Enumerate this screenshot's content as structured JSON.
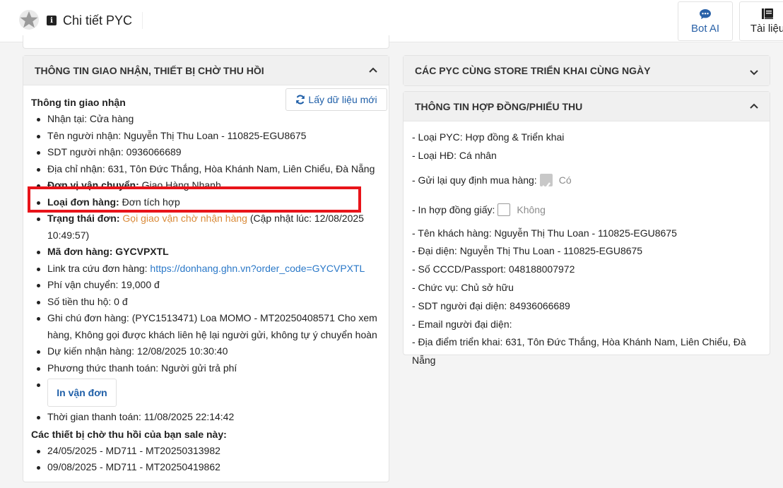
{
  "header": {
    "title": "Chi tiết PYC",
    "bot_ai_label": "Bot AI",
    "docs_label": "Tài liệu"
  },
  "left_panel": {
    "title": "THÔNG TIN GIAO NHẬN, THIẾT BỊ CHỜ THU HỒI",
    "section_delivery": "Thông tin giao nhận",
    "refresh_label": "Lấy dữ liệu mới",
    "items": {
      "receive_at": "Nhận tại: Cửa hàng",
      "receiver_name": "Tên người nhận: Nguyễn Thị Thu Loan - 110825-EGU8675",
      "receiver_phone": "SDT người nhận: 0936066689",
      "address": "Địa chỉ nhận: 631, Tôn Đức Thắng, Hòa Khánh Nam, Liên Chiểu, Đà Nẵng",
      "carrier_label": "Đơn vị vận chuyển:",
      "carrier_value": "Giao Hàng Nhanh",
      "order_type_label": "Loại đơn hàng:",
      "order_type_value": "Đơn tích hợp",
      "status_label": "Trạng thái đơn:",
      "status_value": "Gọi giao vận chờ nhận hàng",
      "status_updated": "(Cập nhật lúc: 12/08/2025 10:49:57)",
      "order_code_label": "Mã đơn hàng:",
      "order_code_value": "GYCVPXTL",
      "tracking_label": "Link tra cứu đơn hàng:",
      "tracking_url": "https://donhang.ghn.vn?order_code=GYCVPXTL",
      "shipping_fee": "Phí vận chuyển: 19,000 đ",
      "cod_amount": "Số tiền thu hộ: 0 đ",
      "order_note": "Ghi chú đơn hàng: (PYC1513471) Loa MOMO - MT20250408571 Cho xem hàng, Không gọi được khách liên hệ lại người gửi, không tự ý chuyển hoàn",
      "expected_receive": "Dự kiến nhận hàng: 12/08/2025 10:30:40",
      "payment_method": "Phương thức thanh toán: Người gửi trả phí",
      "print_label": "In vận đơn",
      "payment_time": "Thời gian thanh toán: 11/08/2025 22:14:42"
    },
    "section_devices": "Các thiết bị chờ thu hồi của bạn sale này:",
    "devices": [
      "24/05/2025 - MD711 - MT20250313982",
      "09/08/2025 - MD711 - MT20250419862"
    ]
  },
  "right_top_panel": {
    "title": "CÁC PYC CÙNG STORE TRIỂN KHAI CÙNG NGÀY"
  },
  "right_bottom_panel": {
    "title": "THÔNG TIN HỢP ĐỒNG/PHIẾU THU",
    "pyc_type": "- Loại PYC: Hợp đồng & Triển khai",
    "contract_type": "- Loại HĐ: Cá nhân",
    "resend_label": "- Gửi lại quy định mua hàng:",
    "resend_value": "Có",
    "print_contract_label": "- In hợp đồng giấy:",
    "print_contract_value": "Không",
    "customer_name": "- Tên khách hàng: Nguyễn Thị Thu Loan - 110825-EGU8675",
    "representative": "- Đại diện: Nguyễn Thị Thu Loan - 110825-EGU8675",
    "id_number": "- Số CCCD/Passport: 048188007972",
    "position": "- Chức vụ: Chủ sở hữu",
    "rep_phone": "- SDT người đại diện: 84936066689",
    "rep_email": "- Email người đại diện:",
    "deploy_location": "- Địa điểm triển khai: 631, Tôn Đức Thắng, Hòa Khánh Nam, Liên Chiểu, Đà Nẵng"
  },
  "colors": {
    "accent": "#1f5fa8",
    "status_orange": "#d98b3a",
    "highlight_red": "#e8141a",
    "link": "#2a78c8"
  }
}
